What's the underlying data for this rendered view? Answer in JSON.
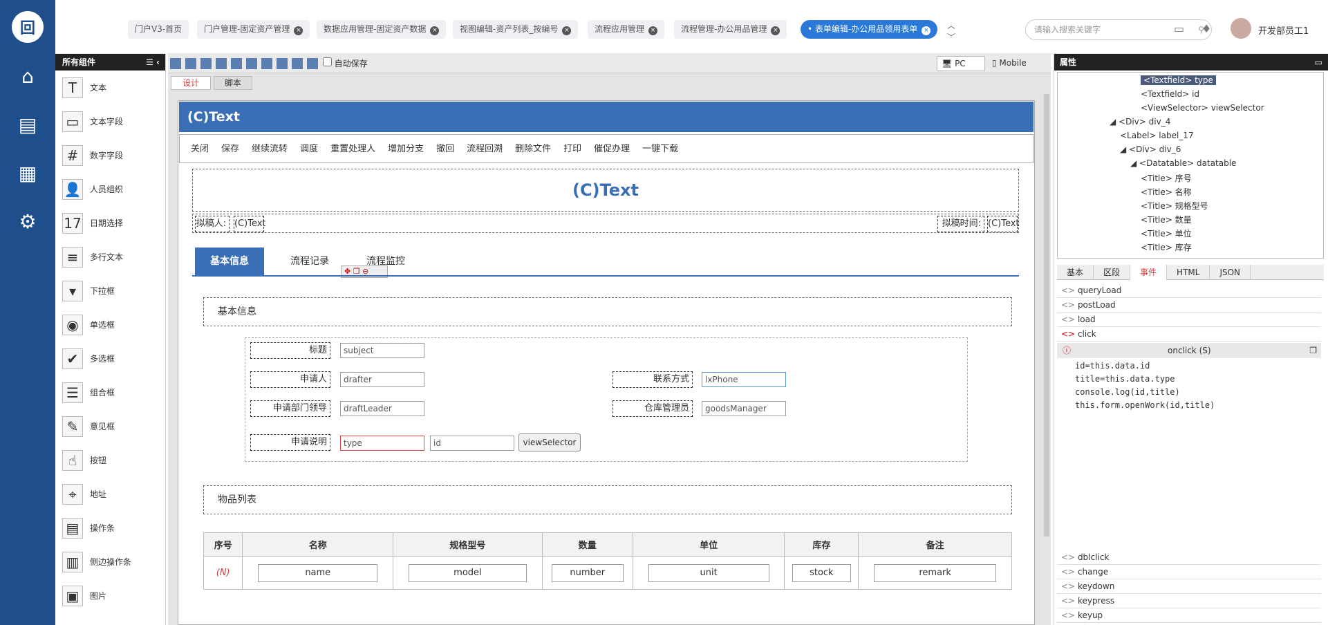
{
  "top_tabs": [
    {
      "label": "门户V3-首页",
      "closable": false
    },
    {
      "label": "门户管理-固定资产管理",
      "closable": true
    },
    {
      "label": "数据应用管理-固定资产数据",
      "closable": true
    },
    {
      "label": "视图编辑-资产列表_按编号",
      "closable": true
    },
    {
      "label": "流程应用管理",
      "closable": true
    },
    {
      "label": "流程管理-办公用品管理",
      "closable": true
    },
    {
      "label": "• 表单编辑-办公用品领用表单",
      "closable": true,
      "active": true
    }
  ],
  "search_placeholder": "请输入搜索关键字",
  "user_name": "开发部员工1",
  "components_title": "所有组件",
  "components": [
    {
      "label": "文本",
      "icon": "T"
    },
    {
      "label": "文本字段",
      "icon": "▭"
    },
    {
      "label": "数字字段",
      "icon": "#"
    },
    {
      "label": "人员组织",
      "icon": "👤"
    },
    {
      "label": "日期选择",
      "icon": "17"
    },
    {
      "label": "多行文本",
      "icon": "≡"
    },
    {
      "label": "下拉框",
      "icon": "▾"
    },
    {
      "label": "单选框",
      "icon": "◉"
    },
    {
      "label": "多选框",
      "icon": "✔"
    },
    {
      "label": "组合框",
      "icon": "☰"
    },
    {
      "label": "意见框",
      "icon": "✎"
    },
    {
      "label": "按钮",
      "icon": "☝"
    },
    {
      "label": "地址",
      "icon": "⌖"
    },
    {
      "label": "操作条",
      "icon": "▤"
    },
    {
      "label": "侧边操作条",
      "icon": "▥"
    },
    {
      "label": "图片",
      "icon": "▣"
    }
  ],
  "toolbar": {
    "autosave_label": "自动保存",
    "pc_label": "PC",
    "mobile_label": "Mobile"
  },
  "design_tabs": [
    "设计",
    "脚本"
  ],
  "form": {
    "header_title": "(C)Text",
    "actions": [
      "关闭",
      "保存",
      "继续流转",
      "调度",
      "重置处理人",
      "增加分支",
      "撤回",
      "流程回溯",
      "删除文件",
      "打印",
      "催促办理",
      "一键下载"
    ],
    "main_title": "(C)Text",
    "drafter_label": "拟稿人:",
    "drafter_value": "(C)Text",
    "draft_time_label": "拟稿时间:",
    "draft_time_value": "(C)Text",
    "tabs": [
      "基本信息",
      "流程记录",
      "流程监控"
    ],
    "section_basic": "基本信息",
    "fields": {
      "title_label": "标题",
      "title_value": "subject",
      "applicant_label": "申请人",
      "applicant_value": "drafter",
      "contact_label": "联系方式",
      "contact_value": "lxPhone",
      "leader_label": "申请部门领导",
      "leader_value": "draftLeader",
      "warehouse_label": "仓库管理员",
      "warehouse_value": "goodsManager",
      "desc_label": "申请说明",
      "type_value": "type",
      "id_value": "id",
      "view_selector": "viewSelector"
    },
    "section_items": "物品列表",
    "table_headers": [
      "序号",
      "名称",
      "规格型号",
      "数量",
      "单位",
      "库存",
      "备注"
    ],
    "table_row": [
      "(N)",
      "name",
      "model",
      "number",
      "unit",
      "stock",
      "remark"
    ]
  },
  "props_title": "属性",
  "tree": [
    {
      "text": "<Textfield> type",
      "selected": true,
      "indent": 4
    },
    {
      "text": "<Textfield> id",
      "indent": 4
    },
    {
      "text": "<ViewSelector> viewSelector",
      "indent": 4
    },
    {
      "text": "◢ <Div> div_4",
      "indent": 1
    },
    {
      "text": "<Label> label_17",
      "indent": 2
    },
    {
      "text": "◢ <Div> div_6",
      "indent": 2
    },
    {
      "text": "◢ <Datatable> datatable",
      "indent": 3
    },
    {
      "text": "<Title> 序号",
      "indent": 4
    },
    {
      "text": "<Title> 名称",
      "indent": 4
    },
    {
      "text": "<Title> 规格型号",
      "indent": 4
    },
    {
      "text": "<Title> 数量",
      "indent": 4
    },
    {
      "text": "<Title> 单位",
      "indent": 4
    },
    {
      "text": "<Title> 库存",
      "indent": 4
    }
  ],
  "prop_tabs": [
    "基本",
    "区段",
    "事件",
    "HTML",
    "JSON"
  ],
  "events_top": [
    "queryLoad",
    "postLoad",
    "load",
    "click"
  ],
  "onclick_title": "onclick (S)",
  "code_lines": [
    "id=this.data.id",
    "title=this.data.type",
    "console.log(id,title)",
    "this.form.openWork(id,title)"
  ],
  "events_bottom": [
    "dblclick",
    "change",
    "keydown",
    "keypress",
    "keyup"
  ],
  "colors": {
    "nav": "#1e4f8c",
    "accent": "#2a79d8",
    "form_header": "#3b6fb5"
  }
}
